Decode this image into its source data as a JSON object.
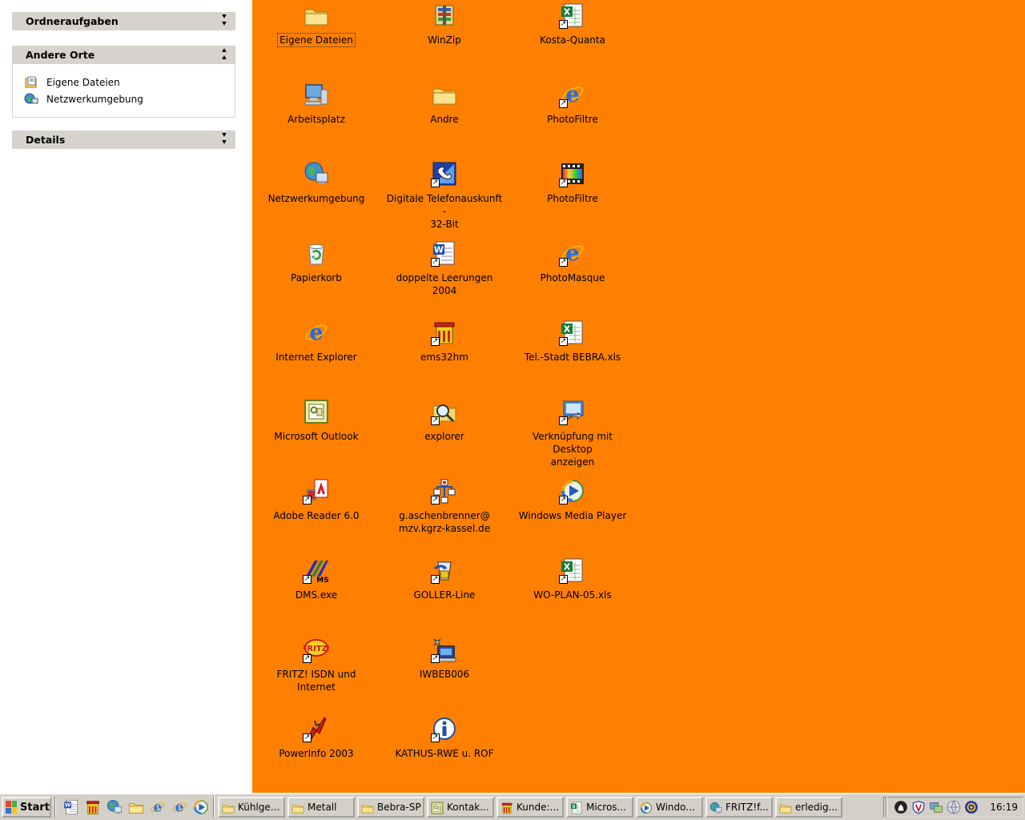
{
  "taskpane": {
    "groups": [
      {
        "title": "Ordneraufgaben",
        "expanded": false
      },
      {
        "title": "Andere Orte",
        "expanded": true,
        "links": [
          "Eigene Dateien",
          "Netzwerkumgebung"
        ]
      },
      {
        "title": "Details",
        "expanded": false
      }
    ]
  },
  "desktop": {
    "background": "#ff8000",
    "icons": [
      {
        "label": "Eigene Dateien",
        "icon": "folder-icon",
        "selected": true
      },
      {
        "label": "WinZip",
        "icon": "winzip-icon"
      },
      {
        "label": "Kosta-Quanta",
        "icon": "excel-icon",
        "shortcut": true
      },
      {
        "label": "Arbeitsplatz",
        "icon": "computer-icon"
      },
      {
        "label": "Andre",
        "icon": "folder-icon"
      },
      {
        "label": "PhotoFiltre",
        "icon": "ie-icon",
        "shortcut": true
      },
      {
        "label": "Netzwerkumgebung",
        "icon": "network-icon"
      },
      {
        "label": "Digitale Telefonauskunft -\n32-Bit",
        "icon": "phone-icon",
        "shortcut": true
      },
      {
        "label": "PhotoFiltre",
        "icon": "photofiltre-icon",
        "shortcut": true
      },
      {
        "label": "Papierkorb",
        "icon": "recycle-bin-icon"
      },
      {
        "label": "doppelte Leerungen 2004",
        "icon": "word-icon",
        "shortcut": true
      },
      {
        "label": "PhotoMasque",
        "icon": "ie-icon",
        "shortcut": true
      },
      {
        "label": "Internet Explorer",
        "icon": "ie-icon"
      },
      {
        "label": "ems32hm",
        "icon": "ems-icon",
        "shortcut": true
      },
      {
        "label": "Tel.-Stadt BEBRA.xls",
        "icon": "excel-icon",
        "shortcut": true
      },
      {
        "label": "Microsoft Outlook",
        "icon": "outlook-icon"
      },
      {
        "label": "explorer",
        "icon": "explorer-icon",
        "shortcut": true
      },
      {
        "label": "Verknüpfung mit Desktop\nanzeigen",
        "icon": "desktop-shortcut-icon",
        "shortcut": true
      },
      {
        "label": "Adobe Reader 6.0",
        "icon": "adobe-icon",
        "shortcut": true
      },
      {
        "label": "g.aschenbrenner@\nmzv.kgrz-kassel.de",
        "icon": "network-tree-icon",
        "shortcut": true
      },
      {
        "label": "Windows Media Player",
        "icon": "media-player-icon",
        "shortcut": true
      },
      {
        "label": "DMS.exe",
        "icon": "dms-icon",
        "shortcut": true
      },
      {
        "label": "GOLLER-Line",
        "icon": "goller-icon",
        "shortcut": true
      },
      {
        "label": "WO-PLAN-05.xls",
        "icon": "excel-icon",
        "shortcut": true
      },
      {
        "label": "FRITZ! ISDN und Internet",
        "icon": "fritz-icon",
        "shortcut": true
      },
      {
        "label": "IWBEB006",
        "icon": "computer-satellite-icon",
        "shortcut": true
      },
      {
        "label": "PowerInfo 2003",
        "icon": "powerinfo-icon",
        "shortcut": true
      },
      {
        "label": "KATHUS-RWE u. ROF",
        "icon": "info-icon",
        "shortcut": true
      }
    ]
  },
  "taskbar": {
    "start_label": "Start",
    "quicklaunch": [
      "word-icon",
      "ems-icon",
      "network-icon",
      "folder-icon",
      "ie-icon",
      "ie-icon",
      "media-player-icon"
    ],
    "buttons": [
      {
        "label": "Kühlge...",
        "icon": "folder-icon"
      },
      {
        "label": "Metall",
        "icon": "folder-icon"
      },
      {
        "label": "Bebra-SP",
        "icon": "folder-icon"
      },
      {
        "label": "Kontak...",
        "icon": "outlook-icon"
      },
      {
        "label": "Kunde:...",
        "icon": "ems-icon"
      },
      {
        "label": "Micros...",
        "icon": "excel-icon"
      },
      {
        "label": "Windo...",
        "icon": "media-player-icon"
      },
      {
        "label": "FRITZ!f...",
        "icon": "network-icon"
      },
      {
        "label": "erledig...",
        "icon": "folder-icon"
      }
    ],
    "tray": [
      "tray-app-icon",
      "antivirus-icon",
      "network-tray-icon",
      "globe-tray-icon",
      "tray-service-icon"
    ],
    "clock": "16:19"
  }
}
